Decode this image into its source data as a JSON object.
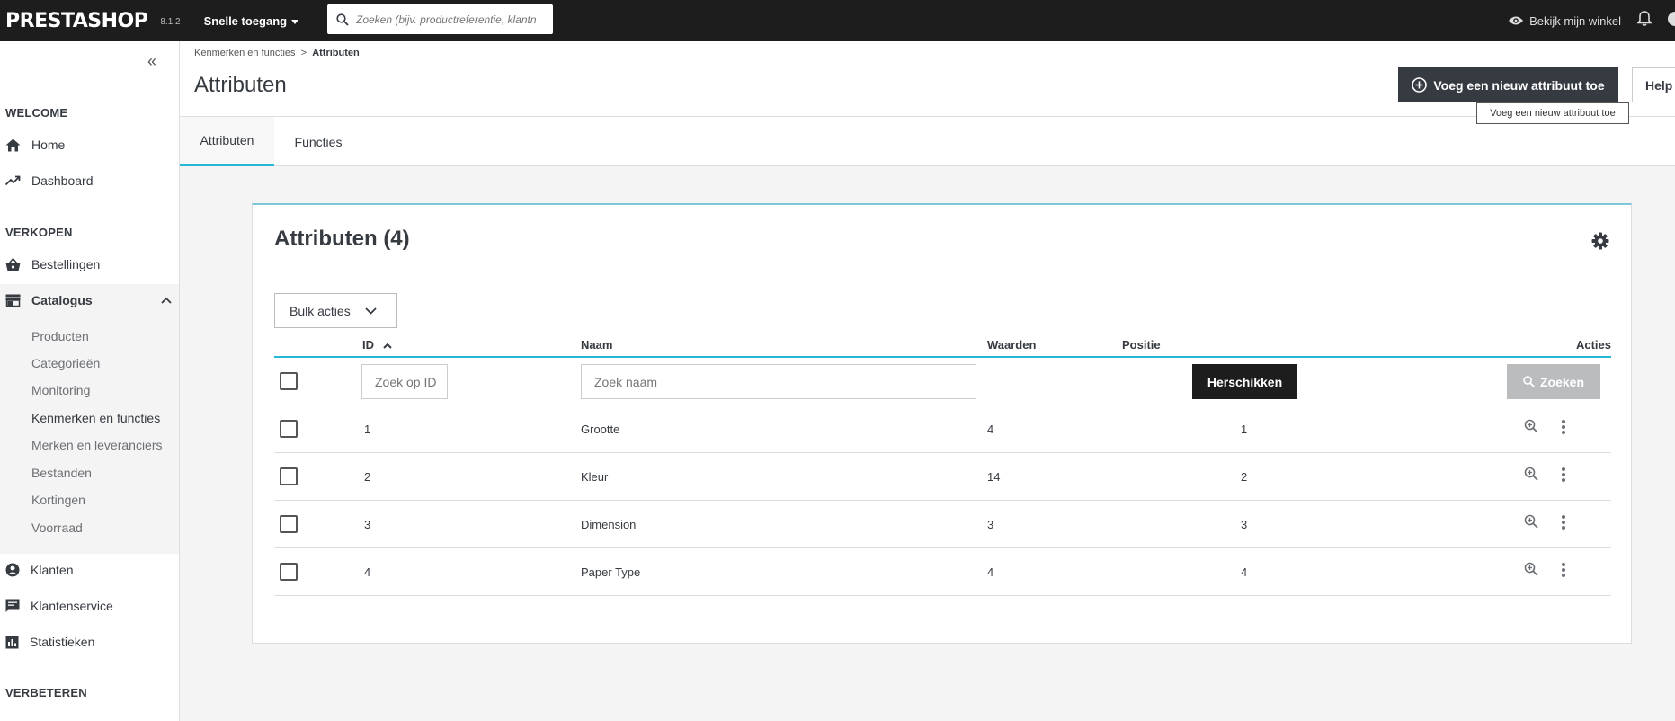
{
  "topbar": {
    "logo": "PRESTASHOP",
    "version": "8.1.2",
    "quick_access": "Snelle toegang",
    "search_placeholder": "Zoeken (bijv. productreferentie, klantn",
    "view_shop": "Bekijk mijn winkel"
  },
  "sidebar": {
    "sections": {
      "welcome": "WELCOME",
      "sell": "VERKOPEN",
      "improve": "VERBETEREN"
    },
    "items": {
      "home": "Home",
      "dashboard": "Dashboard",
      "orders": "Bestellingen",
      "catalog": "Catalogus",
      "customers": "Klanten",
      "customer_service": "Klantenservice",
      "stats": "Statistieken"
    },
    "catalog_sub": [
      "Producten",
      "Categorieën",
      "Monitoring",
      "Kenmerken en functies",
      "Merken en leveranciers",
      "Bestanden",
      "Kortingen",
      "Voorraad"
    ]
  },
  "header": {
    "breadcrumb_parent": "Kenmerken en functies",
    "breadcrumb_sep": ">",
    "breadcrumb_current": "Attributen",
    "title": "Attributen",
    "add_button": "Voeg een nieuw attribuut toe",
    "help_button": "Help",
    "tooltip": "Voeg een nieuw attribuut toe"
  },
  "tabs": [
    "Attributen",
    "Functies"
  ],
  "grid": {
    "title": "Attributen (4)",
    "bulk_actions": "Bulk acties",
    "columns": {
      "id": "ID",
      "name": "Naam",
      "values": "Waarden",
      "position": "Positie",
      "actions": "Acties"
    },
    "filters": {
      "id_placeholder": "Zoek op ID",
      "name_placeholder": "Zoek naam",
      "resort_button": "Herschikken",
      "search_button": "Zoeken"
    },
    "rows": [
      {
        "id": "1",
        "name": "Grootte",
        "values": "4",
        "position": "1"
      },
      {
        "id": "2",
        "name": "Kleur",
        "values": "14",
        "position": "2"
      },
      {
        "id": "3",
        "name": "Dimension",
        "values": "3",
        "position": "3"
      },
      {
        "id": "4",
        "name": "Paper Type",
        "values": "4",
        "position": "4"
      }
    ]
  },
  "colors": {
    "topbar": "#1d1d1d",
    "accent": "#25b9d7",
    "dark_button": "#363a41",
    "disabled_button": "#bbbcbe"
  },
  "icons": [
    "search-icon",
    "eye-icon",
    "bell-icon",
    "collapse-icon",
    "home-icon",
    "trending-icon",
    "basket-icon",
    "store-icon",
    "chevron-up-icon",
    "account-icon",
    "chat-icon",
    "chart-icon",
    "plus-circle-icon",
    "gear-icon",
    "chevron-down-icon",
    "sort-asc-icon",
    "zoom-icon",
    "more-vert-icon"
  ]
}
